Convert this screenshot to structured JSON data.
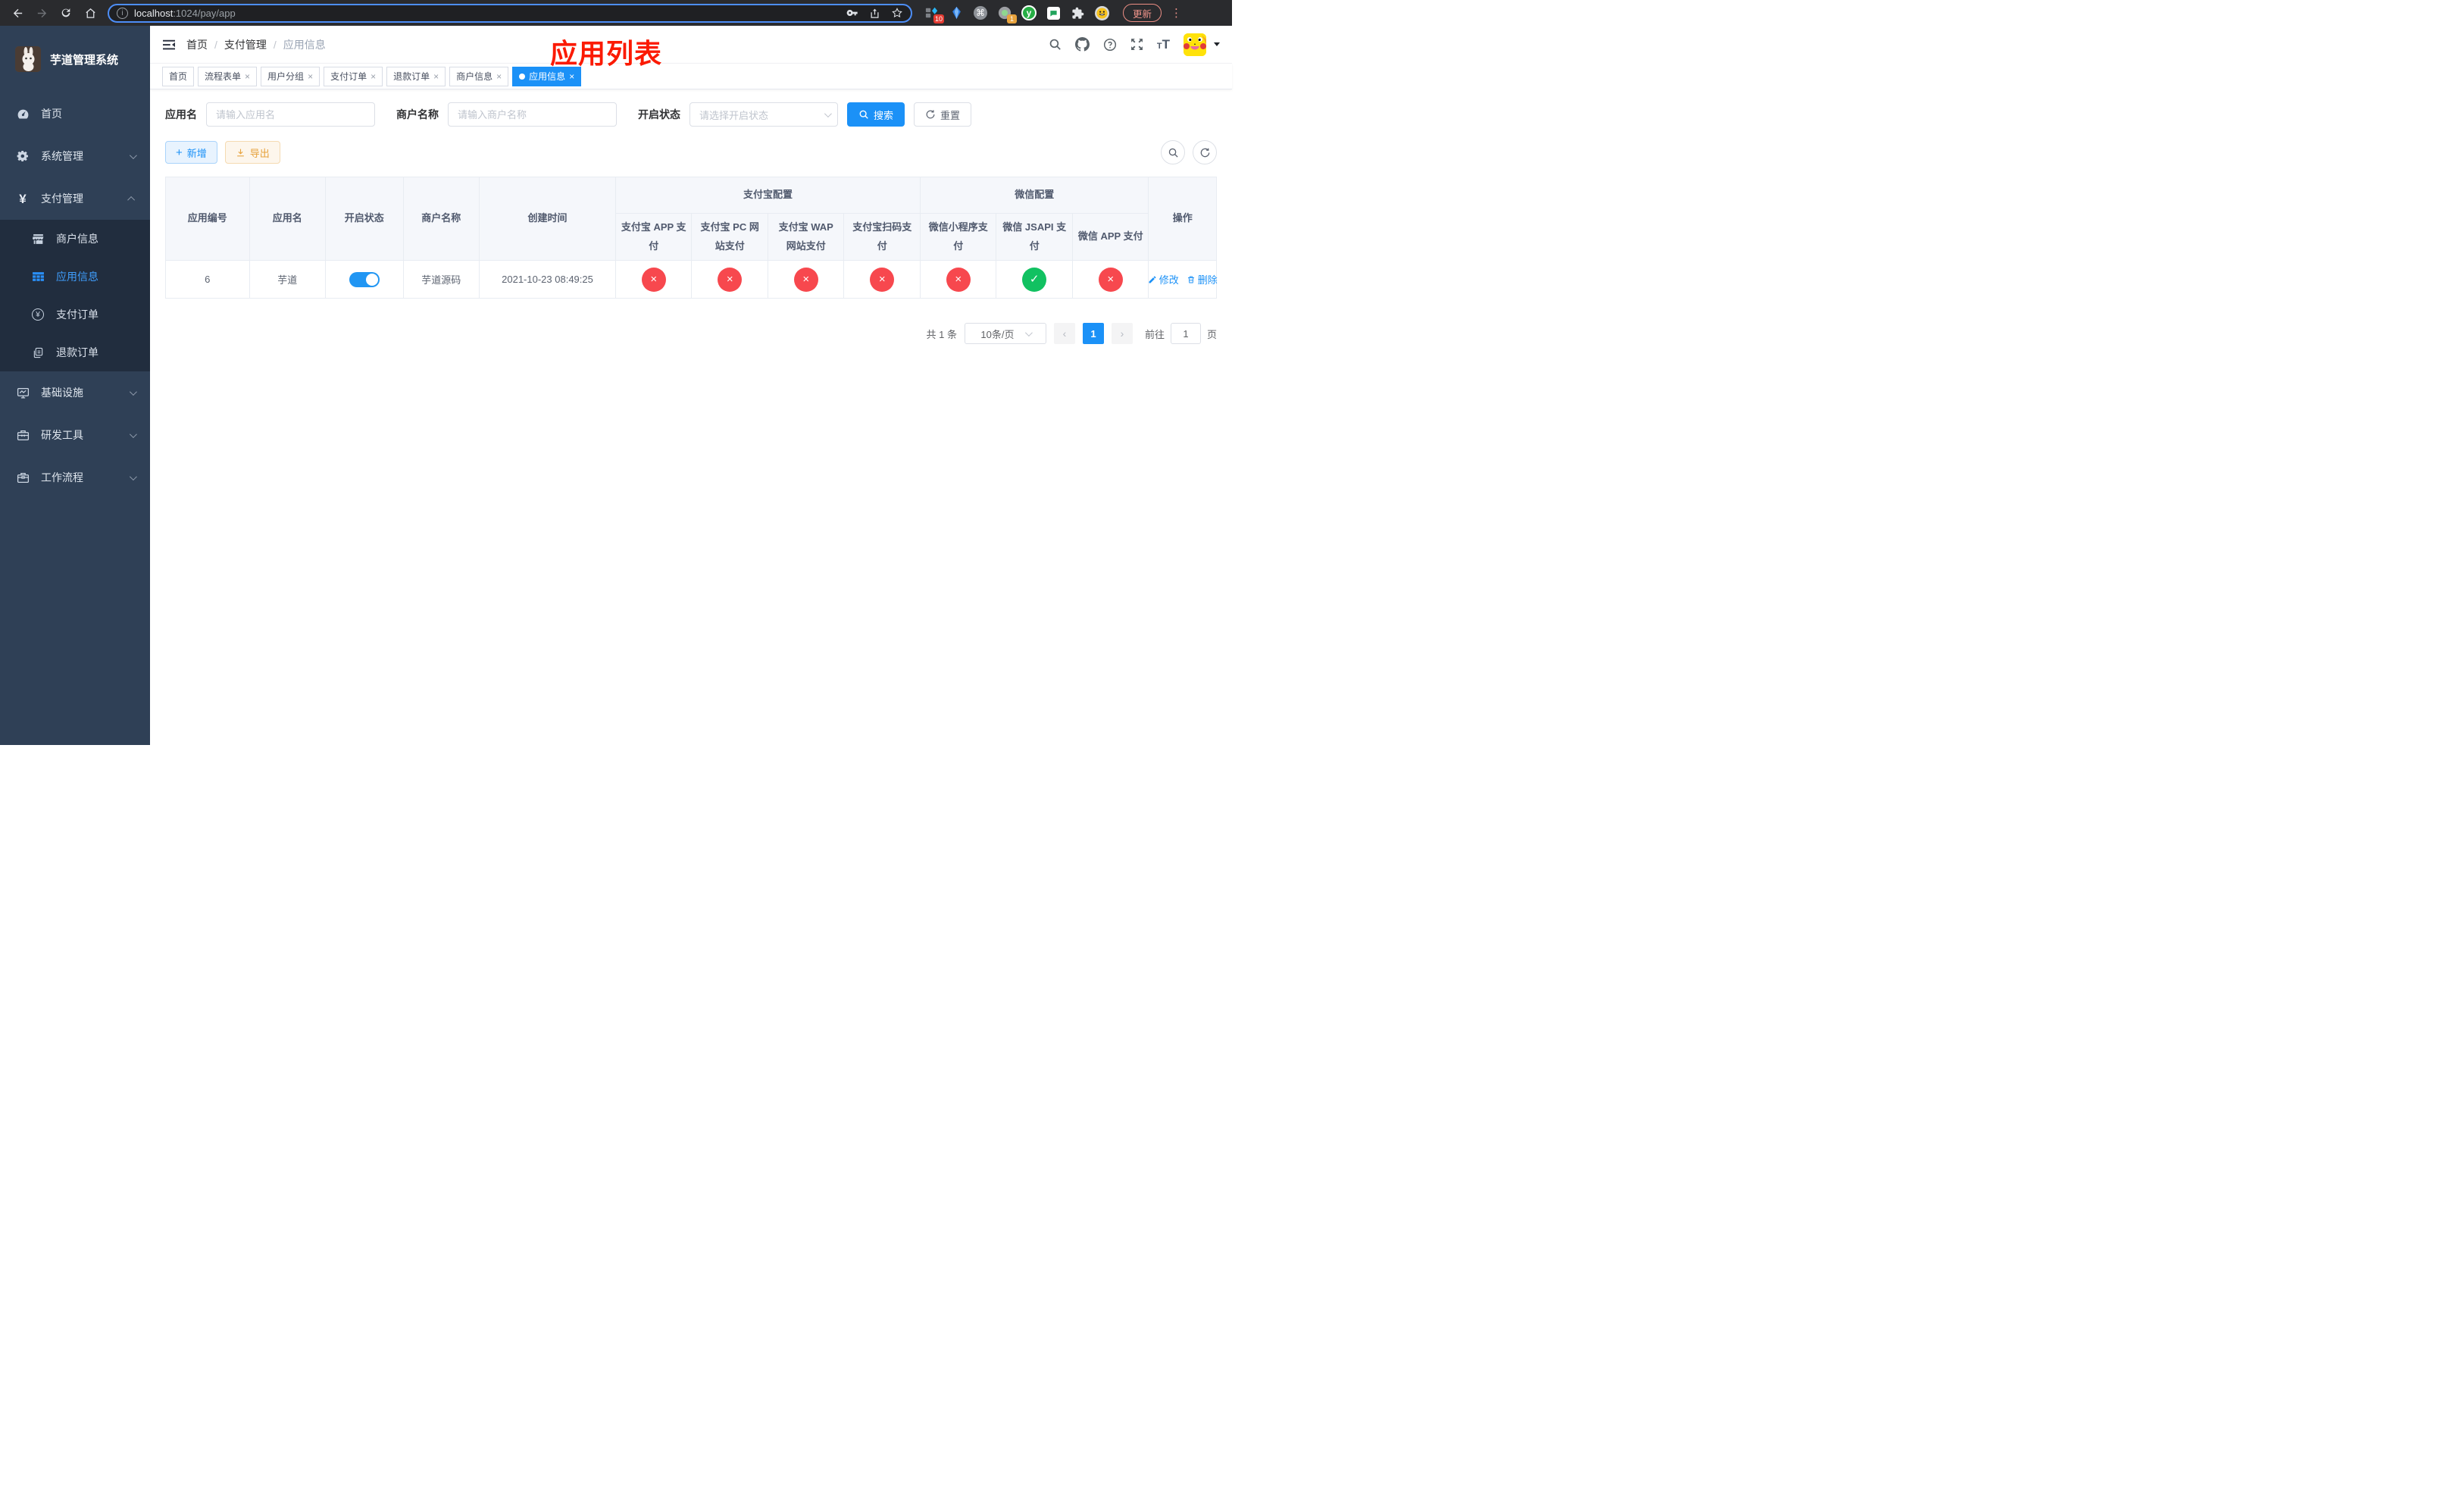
{
  "colors": {
    "primary": "#1b91f7",
    "danger": "#f7484e",
    "success": "#11c161",
    "warning": "#e6a23c",
    "sidebar": "#2f4056",
    "submenu": "#212d3e"
  },
  "browser": {
    "url_host": "localhost",
    "url_rest": ":1024/pay/app",
    "update_label": "更新",
    "ext_badge_1": "10",
    "ext_badge_2": "1",
    "ext_y_label": "y"
  },
  "sidebar": {
    "title": "芋道管理系统",
    "items": [
      {
        "label": "首页"
      },
      {
        "label": "系统管理"
      },
      {
        "label": "支付管理"
      },
      {
        "label": "基础设施"
      },
      {
        "label": "研发工具"
      },
      {
        "label": "工作流程"
      }
    ],
    "pay_children": [
      {
        "label": "商户信息"
      },
      {
        "label": "应用信息",
        "active": true
      },
      {
        "label": "支付订单"
      },
      {
        "label": "退款订单"
      }
    ]
  },
  "navbar": {
    "breadcrumb": [
      "首页",
      "支付管理",
      "应用信息"
    ],
    "annotation": "应用列表"
  },
  "tabs": [
    {
      "label": "首页",
      "closable": false
    },
    {
      "label": "流程表单",
      "closable": true
    },
    {
      "label": "用户分组",
      "closable": true
    },
    {
      "label": "支付订单",
      "closable": true
    },
    {
      "label": "退款订单",
      "closable": true
    },
    {
      "label": "商户信息",
      "closable": true
    },
    {
      "label": "应用信息",
      "closable": true,
      "active": true
    }
  ],
  "filters": {
    "app_name_label": "应用名",
    "app_name_placeholder": "请输入应用名",
    "merchant_label": "商户名称",
    "merchant_placeholder": "请输入商户名称",
    "status_label": "开启状态",
    "status_placeholder": "请选择开启状态",
    "search_label": "搜索",
    "reset_label": "重置"
  },
  "toolbar": {
    "add_label": "新增",
    "export_label": "导出"
  },
  "table": {
    "columns": [
      "应用编号",
      "应用名",
      "开启状态",
      "商户名称",
      "创建时间"
    ],
    "groups": [
      {
        "label": "支付宝配置",
        "children": [
          "支付宝 APP 支付",
          "支付宝 PC 网站支付",
          "支付宝 WAP 网站支付",
          "支付宝扫码支付"
        ]
      },
      {
        "label": "微信配置",
        "children": [
          "微信小程序支付",
          "微信 JSAPI 支付",
          "微信 APP 支付"
        ]
      }
    ],
    "ops_label": "操作",
    "rows": [
      {
        "id": "6",
        "name": "芋道",
        "enabled": true,
        "merchant": "芋道源码",
        "created": "2021-10-23 08:49:25",
        "channels": [
          false,
          false,
          false,
          false,
          false,
          true,
          false
        ],
        "edit_label": "修改",
        "delete_label": "删除"
      }
    ]
  },
  "pagination": {
    "total": "共 1 条",
    "page_size": "10条/页",
    "page": "1",
    "goto_label": "前往",
    "goto_value": "1",
    "unit_label": "页"
  }
}
